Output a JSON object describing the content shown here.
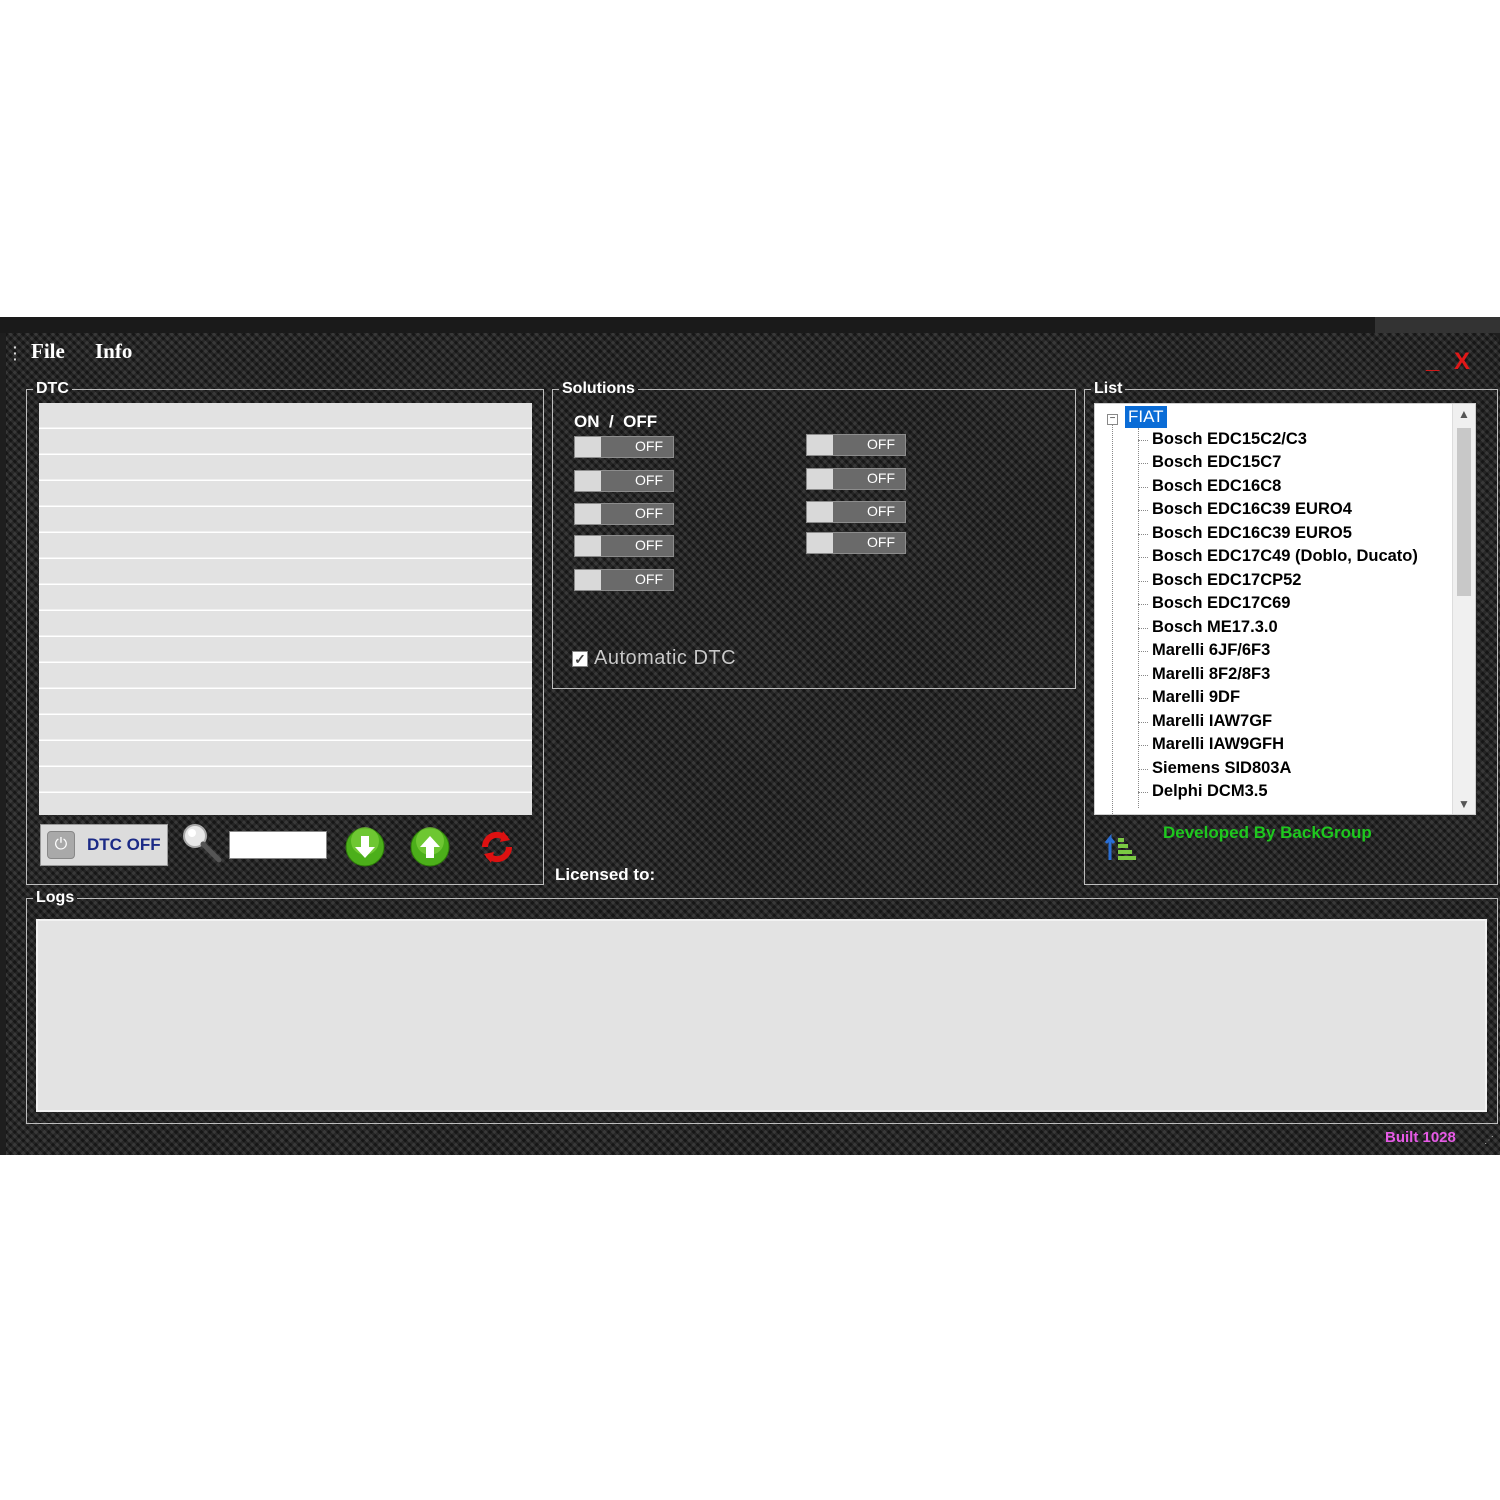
{
  "menu": {
    "file": "File",
    "info": "Info"
  },
  "window_controls": {
    "minimize": "_",
    "close": "X"
  },
  "dtc_group": {
    "legend": "DTC",
    "dtc_off_label": "DTC OFF",
    "search_value": ""
  },
  "solutions_group": {
    "legend": "Solutions",
    "header": "ON  /  OFF",
    "toggles_left": [
      "OFF",
      "OFF",
      "OFF",
      "OFF",
      "OFF"
    ],
    "toggles_right": [
      "OFF",
      "OFF",
      "OFF",
      "OFF"
    ],
    "automatic_dtc_label": "Automatic DTC",
    "automatic_dtc_checked": true
  },
  "licensed_to": "Licensed to:",
  "list_group": {
    "legend": "List",
    "root": "FIAT",
    "items": [
      "Bosch EDC15C2/C3",
      "Bosch EDC15C7",
      "Bosch EDC16C8",
      "Bosch EDC16C39 EURO4",
      "Bosch EDC16C39 EURO5",
      "Bosch EDC17C49  (Doblo, Ducato)",
      "Bosch EDC17CP52",
      "Bosch EDC17C69",
      "Bosch ME17.3.0",
      "Marelli 6JF/6F3",
      "Marelli 8F2/8F3",
      "Marelli 9DF",
      "Marelli IAW7GF",
      "Marelli IAW9GFH",
      "Siemens SID803A",
      "Delphi DCM3.5"
    ],
    "developed_by": "Developed By BackGroup"
  },
  "logs_group": {
    "legend": "Logs"
  },
  "built": "Built 1028",
  "colors": {
    "accent_green": "#1ec81e",
    "built_pink": "#e65ae6",
    "close_red": "#e01818",
    "tree_selection": "#0a6cd6"
  },
  "icons": [
    "power-icon",
    "magnifier-icon",
    "arrow-down-icon",
    "arrow-up-icon",
    "refresh-icon",
    "sort-icon"
  ]
}
